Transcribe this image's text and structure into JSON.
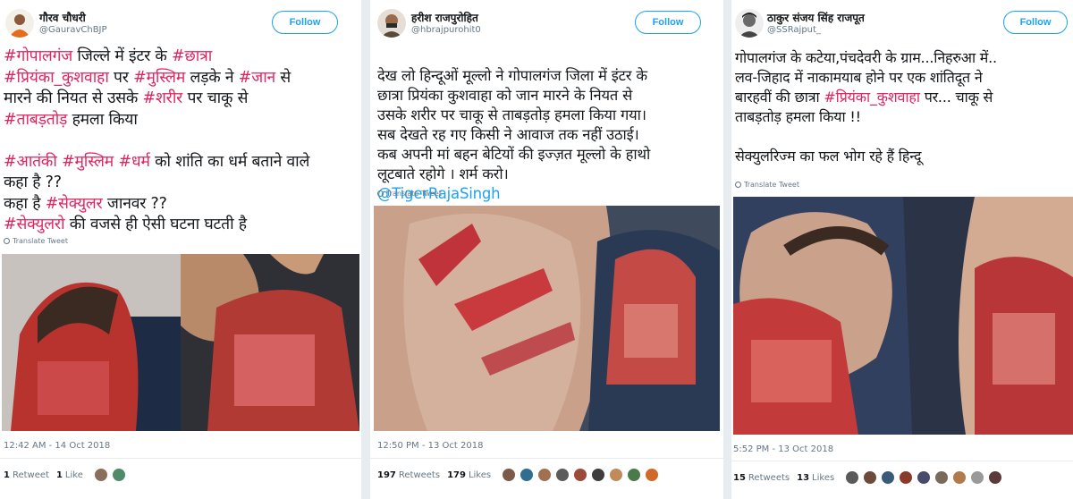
{
  "tweets": [
    {
      "display_name": "गौरव चौधरी",
      "handle": "@GauravChBJP",
      "follow_label": "Follow",
      "text_segments": [
        {
          "t": "#गोपालगंज",
          "h": true
        },
        {
          "t": " जिल्ले में इंटर के ",
          "h": false
        },
        {
          "t": "#छात्रा",
          "h": true
        },
        {
          "t": "\n",
          "h": false
        },
        {
          "t": "#प्रियंका_कुशवाहा",
          "h": true
        },
        {
          "t": " पर ",
          "h": false
        },
        {
          "t": "#मुस्लिम",
          "h": true
        },
        {
          "t": " लड़के ने  ",
          "h": false
        },
        {
          "t": "#जान",
          "h": true
        },
        {
          "t": " से\nमारने की नियत से उसके ",
          "h": false
        },
        {
          "t": "#शरीर",
          "h": true
        },
        {
          "t": " पर चाकू से\n",
          "h": false
        },
        {
          "t": "#ताबड़तोड़",
          "h": true
        },
        {
          "t": " हमला किया\n\n",
          "h": false
        },
        {
          "t": "#आतंकी",
          "h": true
        },
        {
          "t": " ",
          "h": false
        },
        {
          "t": "#मुस्लिम",
          "h": true
        },
        {
          "t": " ",
          "h": false
        },
        {
          "t": "#धर्म",
          "h": true
        },
        {
          "t": " को शांति का धर्म बताने वाले\nकहा है ??\nकहा है ",
          "h": false
        },
        {
          "t": "#सेक्युलर",
          "h": true
        },
        {
          "t": " जानवर ??\n",
          "h": false
        },
        {
          "t": "#सेक्युलरो",
          "h": true
        },
        {
          "t": " की वजसे ही ऐसी घटना घटती है",
          "h": false
        }
      ],
      "translate_label": "Translate Tweet",
      "timestamp": "12:42 AM - 14 Oct 2018",
      "retweets_count": "1",
      "retweets_label": "Retweet",
      "likes_count": "1",
      "likes_label": "Like",
      "liker_colors": [
        "#8a6e5c",
        "#4f8a6b"
      ]
    },
    {
      "display_name": "हरीश राजपुरोहित",
      "handle": "@hbrajpurohit0",
      "follow_label": "Follow",
      "text_segments": [
        {
          "t": "देख लो हिन्दूओं मूल्लो ने गोपालगंज जिला में इंटर के\nछात्रा प्रियंका कुशवाहा को जान मारने के नियत से\nउसके शरीर पर चाकू से ताबड़तोड़ हमला किया गया।\nसब देखते रह गए किसी ने आवाज तक नहीं उठाई।\nकब अपनी मां बहन बेटियों की इज्ज़त मूल्लो के हाथो\nलूटबाते रहोगे । शर्म करो।",
          "h": false
        }
      ],
      "mention": "@TigerRajaSingh",
      "translate_label": "Translate Tweet",
      "timestamp": "12:50 PM - 13 Oct 2018",
      "retweets_count": "197",
      "retweets_label": "Retweets",
      "likes_count": "179",
      "likes_label": "Likes",
      "liker_colors": [
        "#7a5a48",
        "#2f6e8e",
        "#a07050",
        "#5b5b5b",
        "#9c4a3a",
        "#3d3d3d",
        "#c08a5a",
        "#4a7a4a",
        "#d06a2a"
      ]
    },
    {
      "display_name": "ठाकुर संजय सिंह राजपूत",
      "handle": "@SSRajput_",
      "follow_label": "Follow",
      "text_segments": [
        {
          "t": "गोपालगंज के कटेया,पंचदेवरी के ग्राम...निहरुआ में..\nलव-जिहाद में नाकामयाब होने पर एक शांतिदूत ने\nबारहवीं की छात्रा ",
          "h": false
        },
        {
          "t": "#प्रियंका_कुशवाहा",
          "h": true
        },
        {
          "t": " पर... चाकू से\nताबड़तोड़ हमला किया !!\n\nसेक्युलरिज्म का फल भोग रहे हैं हिन्दू",
          "h": false
        }
      ],
      "translate_label": "Translate Tweet",
      "timestamp": "5:52 PM - 13 Oct 2018",
      "retweets_count": "15",
      "retweets_label": "Retweets",
      "likes_count": "13",
      "likes_label": "Likes",
      "liker_colors": [
        "#5a5a5a",
        "#6e4a3a",
        "#3a5a7a",
        "#8a3a2a",
        "#4a4a6a",
        "#7a6a5a",
        "#b07a4a",
        "#9a9a9a",
        "#5a3a3a"
      ]
    }
  ],
  "accent_color": "#1da1f2",
  "hashtag_color": "#e0245e"
}
